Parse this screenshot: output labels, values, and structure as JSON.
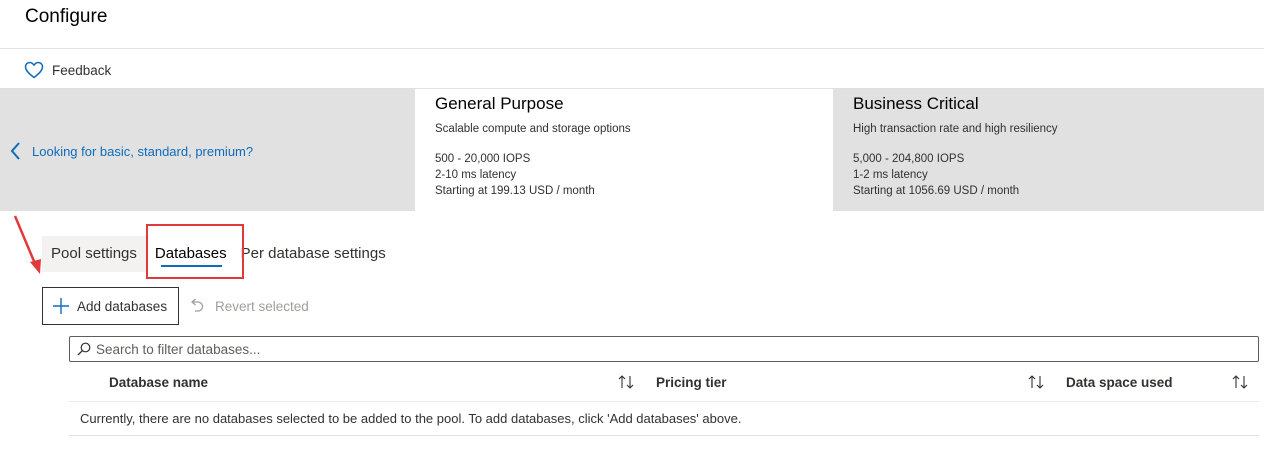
{
  "header": {
    "title": "Configure",
    "feedback_label": "Feedback"
  },
  "tier_selector": {
    "back_link": "Looking for basic, standard, premium?",
    "tiers": [
      {
        "name": "General Purpose",
        "description": "Scalable compute and storage options",
        "iops": "500 - 20,000 IOPS",
        "latency": "2-10 ms latency",
        "price": "Starting at 199.13 USD / month",
        "selected": true
      },
      {
        "name": "Business Critical",
        "description": "High transaction rate and high resiliency",
        "iops": "5,000 - 204,800 IOPS",
        "latency": "1-2 ms latency",
        "price": "Starting at 1056.69 USD / month",
        "selected": false
      }
    ]
  },
  "tabs": [
    {
      "label": "Pool settings"
    },
    {
      "label": "Databases",
      "active": true
    },
    {
      "label": "Per database settings"
    }
  ],
  "toolbar": {
    "add_label": "Add databases",
    "revert_label": "Revert selected"
  },
  "search": {
    "placeholder": "Search to filter databases..."
  },
  "table": {
    "columns": [
      "Database name",
      "Pricing tier",
      "Data space used"
    ],
    "empty_message": "Currently, there are no databases selected to be added to the pool. To add databases, click 'Add databases' above."
  },
  "colors": {
    "accent": "#0f6cbd",
    "annotation_red": "#e03a3a",
    "tier_background": "#e1e1e1"
  }
}
